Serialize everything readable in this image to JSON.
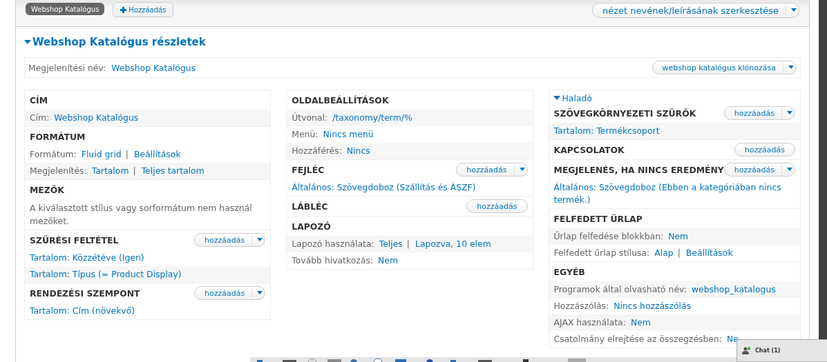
{
  "top_bar": {
    "tabs": [
      {
        "label": "Webshop Katalógus",
        "selected": true
      }
    ],
    "add_button": {
      "label": "Hozzáadás"
    },
    "edit_button": {
      "label": "nézet nevének/leírásának szerkesztése",
      "kind": "split"
    }
  },
  "details": {
    "title": "Webshop Katalógus részletek",
    "expanded": true,
    "display_name": {
      "label": "Megjelenítési név:",
      "value": "Webshop Katalógus"
    },
    "clone_button": {
      "label": "webshop katalógus klónozása",
      "kind": "split"
    },
    "columns": [
      {
        "sections": [
          {
            "title": "CÍM",
            "rows": [
              {
                "kind": "field",
                "label": "Cím:",
                "values": [
                  "Webshop Katalógus"
                ]
              }
            ]
          },
          {
            "title": "FORMÁTUM",
            "rows": [
              {
                "kind": "field",
                "label": "Formátum:",
                "values": [
                  "Fluid grid",
                  "Beállítások"
                ],
                "separator": "|"
              },
              {
                "kind": "field",
                "label": "Megjelenítés:",
                "values": [
                  "Tartalom",
                  "Teljes tartalom"
                ],
                "separator": "|"
              }
            ]
          },
          {
            "title": "MEZŐK",
            "rows": [
              {
                "kind": "note",
                "text": "A kiválasztott stílus vagy sorformátum nem használ mezőket."
              }
            ]
          },
          {
            "title": "SZŰRÉSI FELTÉTEL",
            "add": {
              "label": "hozzáadás",
              "kind": "split"
            },
            "rows": [
              {
                "kind": "link",
                "text": "Tartalom: Közzétéve (Igen)"
              },
              {
                "kind": "link",
                "text": "Tartalom: Típus (= Product Display)"
              }
            ]
          },
          {
            "title": "RENDEZÉSI SZEMPONT",
            "add": {
              "label": "hozzáadás",
              "kind": "split"
            },
            "rows": [
              {
                "kind": "link",
                "text": "Tartalom: Cím (növekvő)"
              }
            ]
          }
        ]
      },
      {
        "sections": [
          {
            "title": "OLDALBEÁLLÍTÁSOK",
            "rows": [
              {
                "kind": "field",
                "label": "Útvonal:",
                "values": [
                  "/taxonomy/term/%"
                ]
              },
              {
                "kind": "field",
                "label": "Menü:",
                "values": [
                  "Nincs menü"
                ]
              },
              {
                "kind": "field",
                "label": "Hozzáférés:",
                "values": [
                  "Nincs"
                ]
              }
            ]
          },
          {
            "title": "FEJLÉC",
            "add": {
              "label": "hozzáadás",
              "kind": "split"
            },
            "rows": [
              {
                "kind": "link",
                "text": "Általános: Szövegdoboz (Szállítás és ÁSZF)"
              }
            ]
          },
          {
            "title": "LÁBLÉC",
            "add": {
              "label": "hozzáadás",
              "kind": "plain"
            }
          },
          {
            "title": "LAPOZÓ",
            "rows": [
              {
                "kind": "field",
                "label": "Lapozó használata:",
                "values": [
                  "Teljes",
                  "Lapozva, 10 elem"
                ],
                "separator": "|"
              },
              {
                "kind": "field",
                "label": "Tovább hivatkozás:",
                "values": [
                  "Nem"
                ]
              }
            ]
          }
        ]
      },
      {
        "toggle": {
          "label": "Haladó",
          "expanded": true
        },
        "sections": [
          {
            "title": "SZÖVEGKÖRNYEZETI SZŰRŐK",
            "add": {
              "label": "hozzáadás",
              "kind": "split"
            },
            "rows": [
              {
                "kind": "link",
                "text": "Tartalom: Termékcsoport"
              }
            ]
          },
          {
            "title": "KAPCSOLATOK",
            "add": {
              "label": "hozzáadás",
              "kind": "plain"
            }
          },
          {
            "title": "MEGJELENÉS, HA NINCS EREDMÉNY",
            "add": {
              "label": "hozzáadás",
              "kind": "split"
            },
            "rows": [
              {
                "kind": "link",
                "text": "Általános: Szövegdoboz (Ebben a kategóriában nincs termék.)"
              }
            ]
          },
          {
            "title": "FELFEDETT ŰRLAP",
            "rows": [
              {
                "kind": "field",
                "label": "Űrlap felfedése blokkban:",
                "values": [
                  "Nem"
                ]
              },
              {
                "kind": "field",
                "label": "Felfedett űrlap stílusa:",
                "values": [
                  "Alap",
                  "Beállítások"
                ],
                "separator": "|"
              }
            ]
          },
          {
            "title": "EGYÉB",
            "rows": [
              {
                "kind": "field",
                "label": "Programok által olvasható név:",
                "values": [
                  "webshop_katalogus"
                ]
              },
              {
                "kind": "field",
                "label": "Hozzászólás:",
                "values": [
                  "Nincs hozzászólás"
                ]
              },
              {
                "kind": "field",
                "label": "AJAX használata:",
                "values": [
                  "Nem"
                ]
              },
              {
                "kind": "field",
                "label": "Csatolmány elrejtése az összegzésben:",
                "values": [
                  "Ne"
                ]
              }
            ]
          }
        ]
      }
    ]
  },
  "chat": {
    "label": "Chat (1)"
  }
}
